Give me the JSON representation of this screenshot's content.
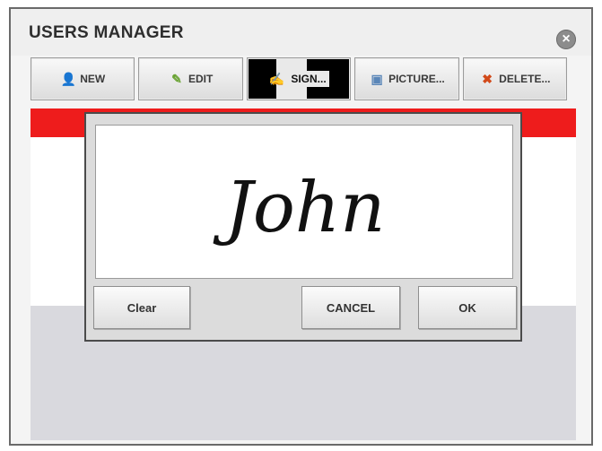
{
  "window": {
    "title": "USERS MANAGER",
    "close_icon": "×"
  },
  "toolbar": {
    "buttons": [
      {
        "label": "NEW",
        "icon": "user-add-icon",
        "glyph": "👤"
      },
      {
        "label": "EDIT",
        "icon": "pencil-icon",
        "glyph": "✎"
      },
      {
        "label": "SIGN...",
        "icon": "signature-icon",
        "glyph": "✍"
      },
      {
        "label": "PICTURE...",
        "icon": "picture-icon",
        "glyph": "▣"
      },
      {
        "label": "DELETE...",
        "icon": "user-delete-icon",
        "glyph": "✖"
      }
    ],
    "active_index": 2
  },
  "colors": {
    "accent_red": "#ee1c1c"
  },
  "sign_dialog": {
    "signature_text": "John",
    "clear_label": "Clear",
    "cancel_label": "CANCEL",
    "ok_label": "OK"
  }
}
